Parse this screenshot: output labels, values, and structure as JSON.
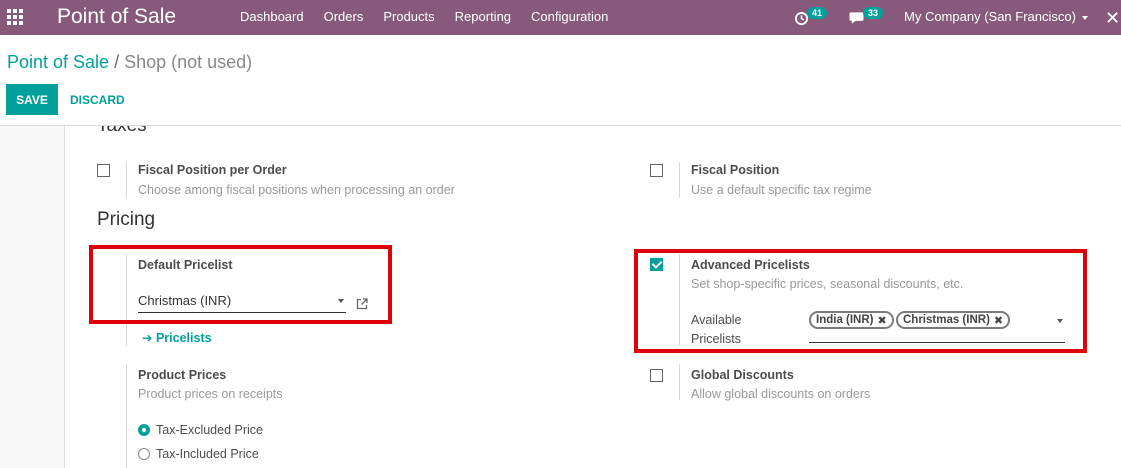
{
  "navbar": {
    "brand": "Point of Sale",
    "menu": [
      "Dashboard",
      "Orders",
      "Products",
      "Reporting",
      "Configuration"
    ],
    "activity_count": "41",
    "messages_count": "33",
    "company": "My Company (San Francisco)"
  },
  "breadcrumb": {
    "parent": "Point of Sale",
    "separator": "/",
    "current": "Shop (not used)"
  },
  "buttons": {
    "save": "SAVE",
    "discard": "DISCARD"
  },
  "sections": {
    "taxes": "Taxes",
    "pricing": "Pricing"
  },
  "settings": {
    "fiscal_position_per_order": {
      "label": "Fiscal Position per Order",
      "help": "Choose among fiscal positions when processing an order",
      "checked": false
    },
    "fiscal_position": {
      "label": "Fiscal Position",
      "help": "Use a default specific tax regime",
      "checked": false
    },
    "default_pricelist": {
      "label": "Default Pricelist",
      "value": "Christmas (INR)",
      "link": "Pricelists"
    },
    "advanced_pricelists": {
      "label": "Advanced Pricelists",
      "help": "Set shop-specific prices, seasonal discounts, etc.",
      "checked": true,
      "field_label_1": "Available",
      "field_label_2": "Pricelists",
      "tags": [
        "India (INR)",
        "Christmas (INR)"
      ]
    },
    "product_prices": {
      "label": "Product Prices",
      "help": "Product prices on receipts",
      "options": [
        "Tax-Excluded Price",
        "Tax-Included Price"
      ],
      "selected": "Tax-Excluded Price"
    },
    "global_discounts": {
      "label": "Global Discounts",
      "help": "Allow global discounts on orders",
      "checked": false
    }
  },
  "colors": {
    "navbar": "#875a7b",
    "accent": "#00a09d",
    "highlight": "#e0000a"
  }
}
